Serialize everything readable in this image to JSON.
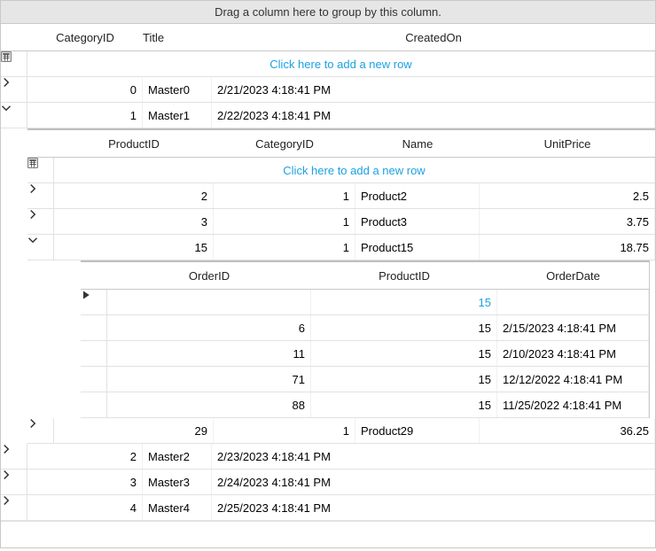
{
  "group_panel_text": "Drag a column here to group by this column.",
  "new_row_text": "Click here to add a new row",
  "master": {
    "columns": {
      "category_id": "CategoryID",
      "title": "Title",
      "created_on": "CreatedOn"
    },
    "rows": [
      {
        "expanded": false,
        "category_id": "0",
        "title": "Master0",
        "created_on": "2/21/2023 4:18:41 PM"
      },
      {
        "expanded": true,
        "category_id": "1",
        "title": "Master1",
        "created_on": "2/22/2023 4:18:41 PM"
      },
      {
        "expanded": false,
        "category_id": "2",
        "title": "Master2",
        "created_on": "2/23/2023 4:18:41 PM"
      },
      {
        "expanded": false,
        "category_id": "3",
        "title": "Master3",
        "created_on": "2/24/2023 4:18:41 PM"
      },
      {
        "expanded": false,
        "category_id": "4",
        "title": "Master4",
        "created_on": "2/25/2023 4:18:41 PM"
      }
    ]
  },
  "products": {
    "columns": {
      "product_id": "ProductID",
      "category_id": "CategoryID",
      "name": "Name",
      "unit_price": "UnitPrice"
    },
    "rows": [
      {
        "expanded": false,
        "product_id": "2",
        "category_id": "1",
        "name": "Product2",
        "unit_price": "2.5"
      },
      {
        "expanded": false,
        "product_id": "3",
        "category_id": "1",
        "name": "Product3",
        "unit_price": "3.75"
      },
      {
        "expanded": true,
        "product_id": "15",
        "category_id": "1",
        "name": "Product15",
        "unit_price": "18.75"
      },
      {
        "expanded": false,
        "product_id": "29",
        "category_id": "1",
        "name": "Product29",
        "unit_price": "36.25"
      }
    ]
  },
  "orders": {
    "columns": {
      "order_id": "OrderID",
      "product_id": "ProductID",
      "order_date": "OrderDate"
    },
    "active_product_id": "15",
    "rows": [
      {
        "order_id": "6",
        "product_id": "15",
        "order_date": "2/15/2023 4:18:41 PM"
      },
      {
        "order_id": "11",
        "product_id": "15",
        "order_date": "2/10/2023 4:18:41 PM"
      },
      {
        "order_id": "71",
        "product_id": "15",
        "order_date": "12/12/2022 4:18:41 PM"
      },
      {
        "order_id": "88",
        "product_id": "15",
        "order_date": "11/25/2022 4:18:41 PM"
      }
    ]
  }
}
